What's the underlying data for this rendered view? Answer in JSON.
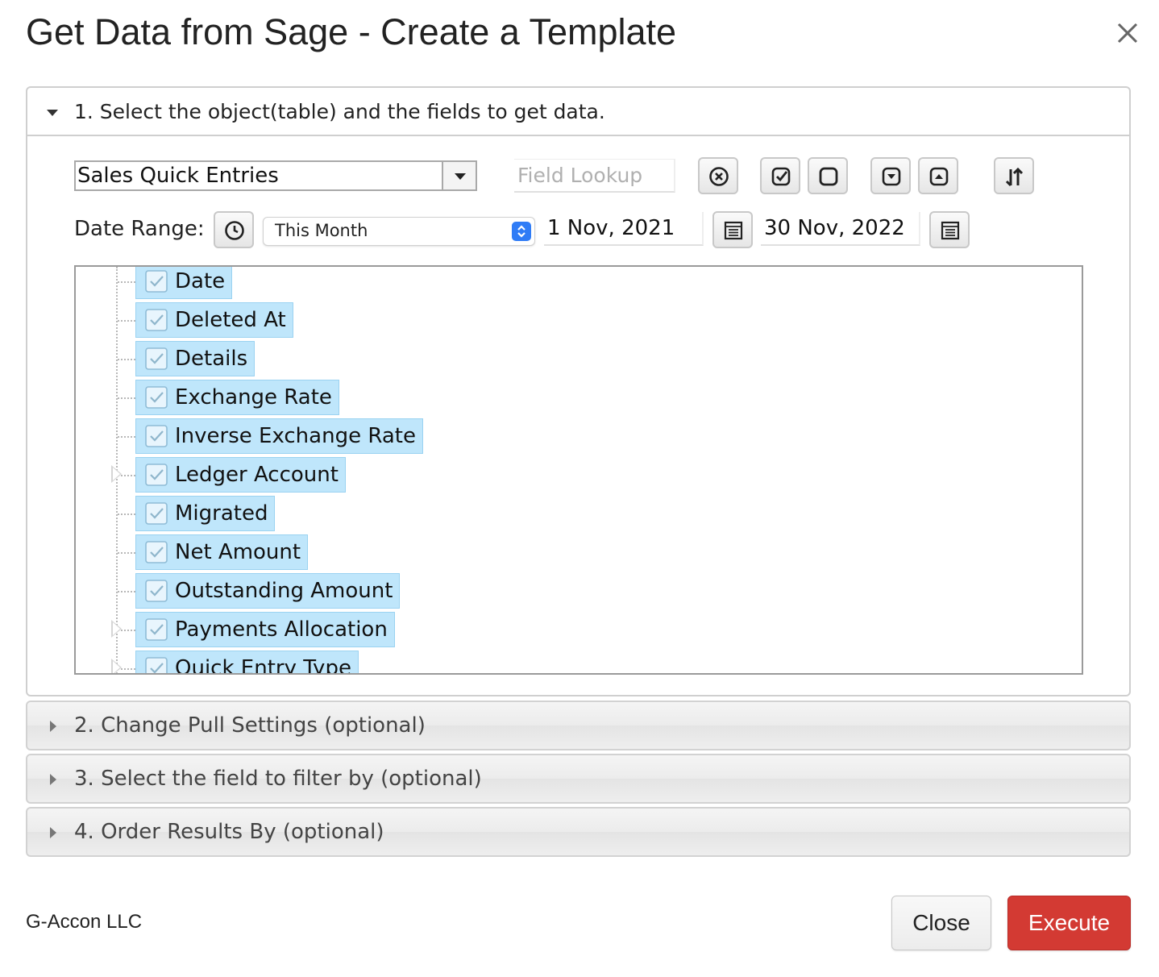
{
  "dialog": {
    "title": "Get Data from Sage - Create a Template",
    "close_icon": "close-icon"
  },
  "section1": {
    "header": "1. Select the object(table) and the fields to get data.",
    "object_select": {
      "value": "Sales Quick Entries"
    },
    "field_lookup": {
      "placeholder": "Field Lookup",
      "value": ""
    },
    "toolbar_icons": [
      "clear-icon",
      "check-all-icon",
      "uncheck-all-icon",
      "collapse-icon",
      "expand-icon",
      "sort-icon"
    ],
    "date_range": {
      "label": "Date Range:",
      "preset": "This Month",
      "start": "1 Nov, 2021",
      "end": "30 Nov, 2022"
    },
    "fields": [
      {
        "label": "Date",
        "checked": true,
        "expandable": false
      },
      {
        "label": "Deleted At",
        "checked": true,
        "expandable": false
      },
      {
        "label": "Details",
        "checked": true,
        "expandable": false
      },
      {
        "label": "Exchange Rate",
        "checked": true,
        "expandable": false
      },
      {
        "label": "Inverse Exchange Rate",
        "checked": true,
        "expandable": false
      },
      {
        "label": "Ledger Account",
        "checked": true,
        "expandable": true
      },
      {
        "label": "Migrated",
        "checked": true,
        "expandable": false
      },
      {
        "label": "Net Amount",
        "checked": true,
        "expandable": false
      },
      {
        "label": "Outstanding Amount",
        "checked": true,
        "expandable": false
      },
      {
        "label": "Payments Allocation",
        "checked": true,
        "expandable": true
      },
      {
        "label": "Quick Entry Type",
        "checked": true,
        "expandable": true
      }
    ]
  },
  "sections": [
    {
      "label": "2. Change Pull Settings (optional)"
    },
    {
      "label": "3. Select the field to filter by (optional)"
    },
    {
      "label": "4. Order Results By (optional)"
    }
  ],
  "footer": {
    "brand": "G-Accon LLC",
    "close_label": "Close",
    "execute_label": "Execute"
  },
  "colors": {
    "chip_bg": "#bfe6fb",
    "execute_bg": "#d33a33",
    "stepper_blue": "#2f7cf6"
  }
}
